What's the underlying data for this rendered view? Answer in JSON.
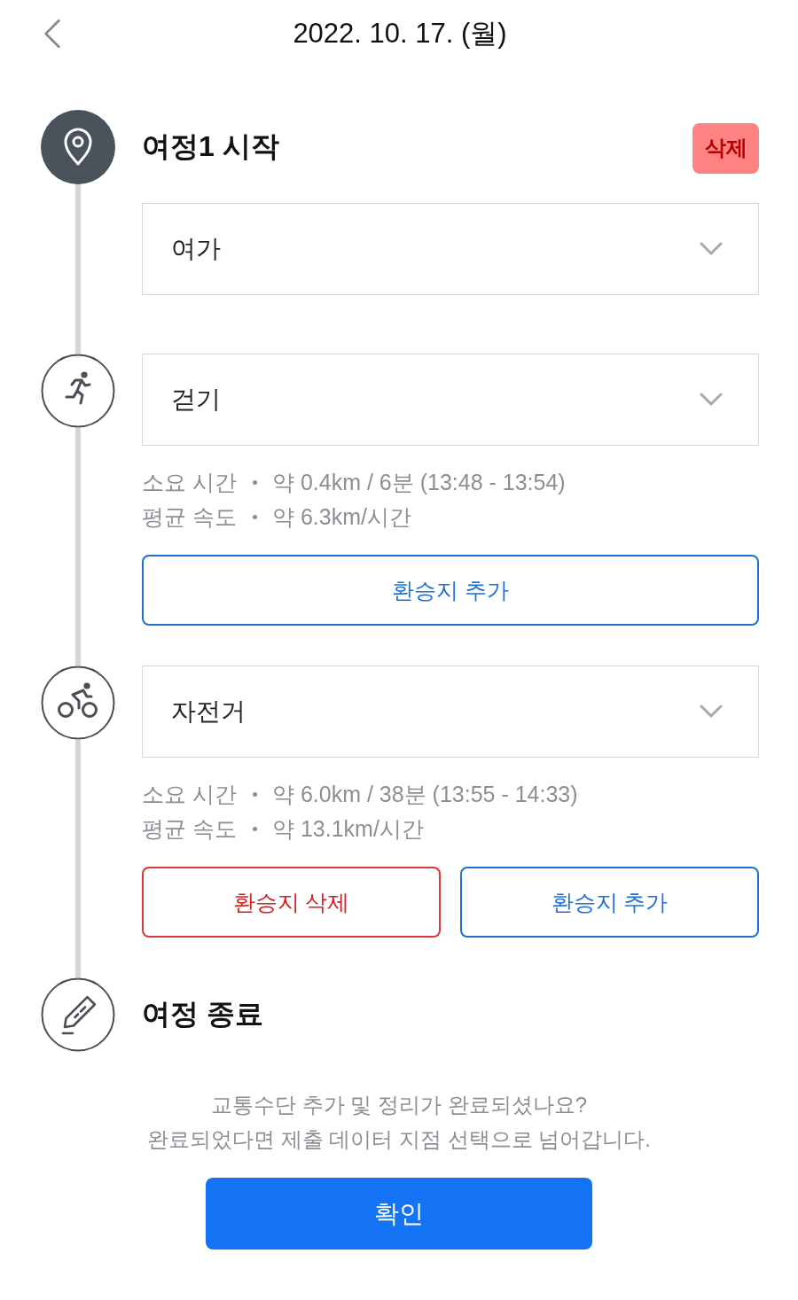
{
  "header": {
    "title": "2022. 10. 17. (월)"
  },
  "start": {
    "title": "여정1 시작",
    "delete_button": "삭제",
    "dropdown": {
      "value": "여가"
    }
  },
  "legs": [
    {
      "kind": "walk",
      "dropdown": {
        "value": "걷기"
      },
      "details": [
        {
          "label": "소요 시간",
          "value": "약 0.4km / 6분 (13:48 - 13:54)"
        },
        {
          "label": "평균 속도",
          "value": "약 6.3km/시간"
        }
      ],
      "actions": [
        {
          "kind": "add",
          "label": "환승지 추가"
        }
      ]
    },
    {
      "kind": "bike",
      "dropdown": {
        "value": "자전거"
      },
      "details": [
        {
          "label": "소요 시간",
          "value": "약 6.0km / 38분 (13:55 - 14:33)"
        },
        {
          "label": "평균 속도",
          "value": "약 13.1km/시간"
        }
      ],
      "actions": [
        {
          "kind": "remove",
          "label": "환승지 삭제"
        },
        {
          "kind": "add",
          "label": "환승지 추가"
        }
      ]
    }
  ],
  "end": {
    "title": "여정 종료"
  },
  "notice": {
    "lines": [
      "교통수단 추가 및 정리가 완료되셨나요?",
      "완료되었다면 제출 데이터 지점 선택으로 넘어갑니다."
    ]
  },
  "confirm_button": "확인"
}
